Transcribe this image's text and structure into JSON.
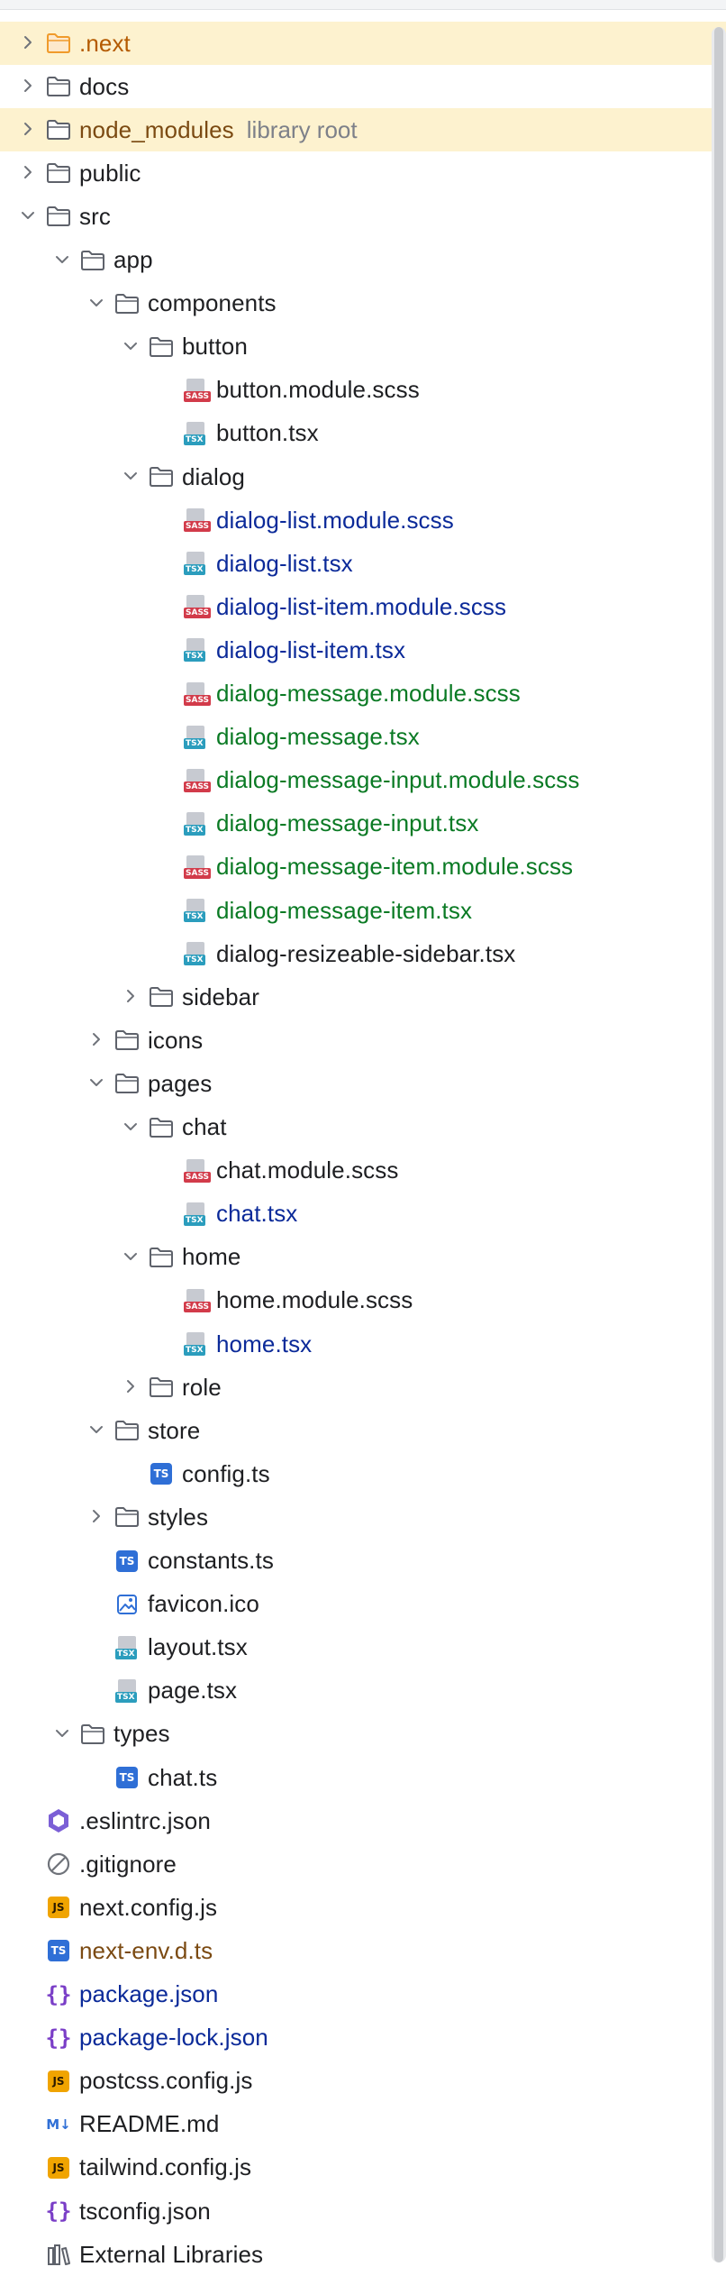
{
  "colors": {
    "highlight_row": "#fdf2cf",
    "text_default": "#1e1f22",
    "text_modified": "#0b2a99",
    "text_added": "#0a7a24",
    "text_excluded": "#7b4a12",
    "text_meta": "#7d8089",
    "folder_stroke": "#5e626b",
    "folder_excluded": "#f09b2b"
  },
  "tree": [
    {
      "label": ".next",
      "depth": 1,
      "kind": "folder",
      "expand": "closed",
      "color": "orange",
      "hl": true,
      "icon_name": "folder-excluded-icon"
    },
    {
      "label": "docs",
      "depth": 1,
      "kind": "folder",
      "expand": "closed",
      "color": "default",
      "icon_name": "folder-icon"
    },
    {
      "label": "node_modules",
      "meta": "library root",
      "depth": 1,
      "kind": "folder",
      "expand": "closed",
      "color": "brown",
      "hl": true,
      "icon_name": "folder-icon"
    },
    {
      "label": "public",
      "depth": 1,
      "kind": "folder",
      "expand": "closed",
      "color": "default",
      "icon_name": "folder-icon"
    },
    {
      "label": "src",
      "depth": 1,
      "kind": "folder",
      "expand": "open",
      "color": "default",
      "icon_name": "folder-icon"
    },
    {
      "label": "app",
      "depth": 2,
      "kind": "folder",
      "expand": "open",
      "color": "default",
      "icon_name": "folder-icon"
    },
    {
      "label": "components",
      "depth": 3,
      "kind": "folder",
      "expand": "open",
      "color": "default",
      "icon_name": "folder-icon"
    },
    {
      "label": "button",
      "depth": 4,
      "kind": "folder",
      "expand": "open",
      "color": "default",
      "icon_name": "folder-icon"
    },
    {
      "label": "button.module.scss",
      "depth": 5,
      "kind": "sass",
      "color": "default",
      "icon_name": "sass-file-icon"
    },
    {
      "label": "button.tsx",
      "depth": 5,
      "kind": "tsx",
      "color": "default",
      "icon_name": "tsx-file-icon"
    },
    {
      "label": "dialog",
      "depth": 4,
      "kind": "folder",
      "expand": "open",
      "color": "default",
      "icon_name": "folder-icon"
    },
    {
      "label": "dialog-list.module.scss",
      "depth": 5,
      "kind": "sass",
      "color": "blue",
      "icon_name": "sass-file-icon"
    },
    {
      "label": "dialog-list.tsx",
      "depth": 5,
      "kind": "tsx",
      "color": "blue",
      "icon_name": "tsx-file-icon"
    },
    {
      "label": "dialog-list-item.module.scss",
      "depth": 5,
      "kind": "sass",
      "color": "blue",
      "icon_name": "sass-file-icon"
    },
    {
      "label": "dialog-list-item.tsx",
      "depth": 5,
      "kind": "tsx",
      "color": "blue",
      "icon_name": "tsx-file-icon"
    },
    {
      "label": "dialog-message.module.scss",
      "depth": 5,
      "kind": "sass",
      "color": "green",
      "icon_name": "sass-file-icon"
    },
    {
      "label": "dialog-message.tsx",
      "depth": 5,
      "kind": "tsx",
      "color": "green",
      "icon_name": "tsx-file-icon"
    },
    {
      "label": "dialog-message-input.module.scss",
      "depth": 5,
      "kind": "sass",
      "color": "green",
      "icon_name": "sass-file-icon"
    },
    {
      "label": "dialog-message-input.tsx",
      "depth": 5,
      "kind": "tsx",
      "color": "green",
      "icon_name": "tsx-file-icon"
    },
    {
      "label": "dialog-message-item.module.scss",
      "depth": 5,
      "kind": "sass",
      "color": "green",
      "icon_name": "sass-file-icon"
    },
    {
      "label": "dialog-message-item.tsx",
      "depth": 5,
      "kind": "tsx",
      "color": "green",
      "icon_name": "tsx-file-icon"
    },
    {
      "label": "dialog-resizeable-sidebar.tsx",
      "depth": 5,
      "kind": "tsx",
      "color": "default",
      "icon_name": "tsx-file-icon"
    },
    {
      "label": "sidebar",
      "depth": 4,
      "kind": "folder",
      "expand": "closed",
      "color": "default",
      "icon_name": "folder-icon"
    },
    {
      "label": "icons",
      "depth": 3,
      "kind": "folder",
      "expand": "closed",
      "color": "default",
      "icon_name": "folder-icon"
    },
    {
      "label": "pages",
      "depth": 3,
      "kind": "folder",
      "expand": "open",
      "color": "default",
      "icon_name": "folder-icon"
    },
    {
      "label": "chat",
      "depth": 4,
      "kind": "folder",
      "expand": "open",
      "color": "default",
      "icon_name": "folder-icon"
    },
    {
      "label": "chat.module.scss",
      "depth": 5,
      "kind": "sass",
      "color": "default",
      "icon_name": "sass-file-icon"
    },
    {
      "label": "chat.tsx",
      "depth": 5,
      "kind": "tsx",
      "color": "blue",
      "icon_name": "tsx-file-icon"
    },
    {
      "label": "home",
      "depth": 4,
      "kind": "folder",
      "expand": "open",
      "color": "default",
      "icon_name": "folder-icon"
    },
    {
      "label": "home.module.scss",
      "depth": 5,
      "kind": "sass",
      "color": "default",
      "icon_name": "sass-file-icon"
    },
    {
      "label": "home.tsx",
      "depth": 5,
      "kind": "tsx",
      "color": "blue",
      "icon_name": "tsx-file-icon"
    },
    {
      "label": "role",
      "depth": 4,
      "kind": "folder",
      "expand": "closed",
      "color": "default",
      "icon_name": "folder-icon"
    },
    {
      "label": "store",
      "depth": 3,
      "kind": "folder",
      "expand": "open",
      "color": "default",
      "icon_name": "folder-icon"
    },
    {
      "label": "config.ts",
      "depth": 4,
      "kind": "ts",
      "color": "default",
      "icon_name": "typescript-file-icon"
    },
    {
      "label": "styles",
      "depth": 3,
      "kind": "folder",
      "expand": "closed",
      "color": "default",
      "icon_name": "folder-icon"
    },
    {
      "label": "constants.ts",
      "depth": 3,
      "kind": "ts",
      "color": "default",
      "icon_name": "typescript-file-icon"
    },
    {
      "label": "favicon.ico",
      "depth": 3,
      "kind": "image",
      "color": "default",
      "icon_name": "image-file-icon"
    },
    {
      "label": "layout.tsx",
      "depth": 3,
      "kind": "tsx",
      "color": "default",
      "icon_name": "tsx-file-icon"
    },
    {
      "label": "page.tsx",
      "depth": 3,
      "kind": "tsx",
      "color": "default",
      "icon_name": "tsx-file-icon"
    },
    {
      "label": "types",
      "depth": 2,
      "kind": "folder",
      "expand": "open",
      "color": "default",
      "icon_name": "folder-icon"
    },
    {
      "label": "chat.ts",
      "depth": 3,
      "kind": "ts",
      "color": "default",
      "icon_name": "typescript-file-icon"
    },
    {
      "label": ".eslintrc.json",
      "depth": 1,
      "kind": "eslint",
      "color": "default",
      "icon_name": "eslint-icon"
    },
    {
      "label": ".gitignore",
      "depth": 1,
      "kind": "ignore",
      "color": "default",
      "icon_name": "gitignore-icon"
    },
    {
      "label": "next.config.js",
      "depth": 1,
      "kind": "js",
      "color": "default",
      "icon_name": "javascript-file-icon"
    },
    {
      "label": "next-env.d.ts",
      "depth": 1,
      "kind": "ts",
      "color": "brown",
      "icon_name": "typescript-file-icon"
    },
    {
      "label": "package.json",
      "depth": 1,
      "kind": "json",
      "color": "blue",
      "icon_name": "json-file-icon"
    },
    {
      "label": "package-lock.json",
      "depth": 1,
      "kind": "json",
      "color": "blue",
      "icon_name": "json-file-icon"
    },
    {
      "label": "postcss.config.js",
      "depth": 1,
      "kind": "js",
      "color": "default",
      "icon_name": "javascript-file-icon"
    },
    {
      "label": "README.md",
      "depth": 1,
      "kind": "md",
      "color": "default",
      "icon_name": "markdown-file-icon"
    },
    {
      "label": "tailwind.config.js",
      "depth": 1,
      "kind": "js",
      "color": "default",
      "icon_name": "javascript-file-icon"
    },
    {
      "label": "tsconfig.json",
      "depth": 1,
      "kind": "json",
      "color": "default",
      "icon_name": "json-file-icon"
    },
    {
      "label": "External Libraries",
      "depth": 0,
      "kind": "libraries",
      "color": "default",
      "icon_name": "external-libraries-icon"
    }
  ]
}
